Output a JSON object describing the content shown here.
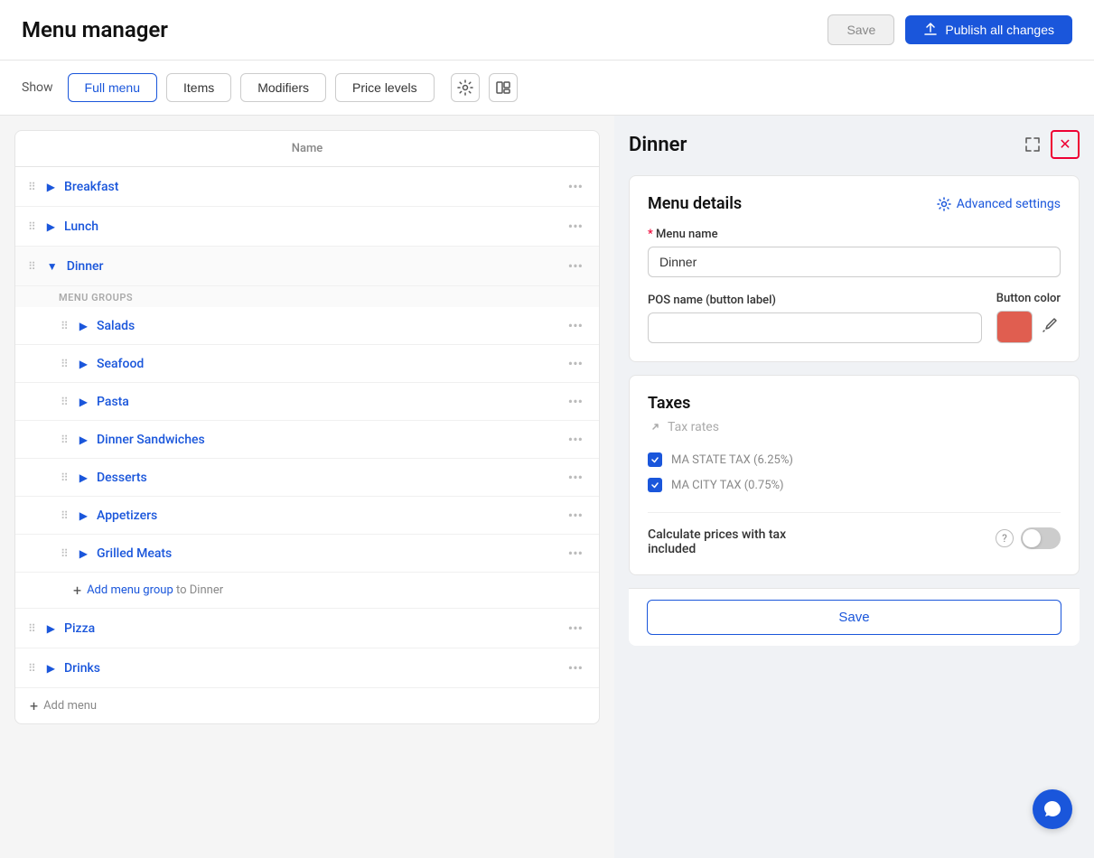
{
  "app": {
    "title": "Menu manager"
  },
  "header": {
    "save_label": "Save",
    "publish_label": "Publish all changes"
  },
  "toolbar": {
    "show_label": "Show",
    "tabs": [
      {
        "id": "full_menu",
        "label": "Full menu",
        "active": true
      },
      {
        "id": "items",
        "label": "Items",
        "active": false
      },
      {
        "id": "modifiers",
        "label": "Modifiers",
        "active": false
      },
      {
        "id": "price_levels",
        "label": "Price levels",
        "active": false
      }
    ]
  },
  "menu_list": {
    "column_header": "Name",
    "items": [
      {
        "id": "breakfast",
        "label": "Breakfast",
        "expanded": false,
        "indent": 0
      },
      {
        "id": "lunch",
        "label": "Lunch",
        "expanded": false,
        "indent": 0
      },
      {
        "id": "dinner",
        "label": "Dinner",
        "expanded": true,
        "indent": 0
      },
      {
        "id": "pizza",
        "label": "Pizza",
        "expanded": false,
        "indent": 0
      },
      {
        "id": "drinks",
        "label": "Drinks",
        "expanded": false,
        "indent": 0
      }
    ],
    "dinner_groups_label": "MENU GROUPS",
    "dinner_groups": [
      {
        "id": "salads",
        "label": "Salads"
      },
      {
        "id": "seafood",
        "label": "Seafood"
      },
      {
        "id": "pasta",
        "label": "Pasta"
      },
      {
        "id": "dinner_sandwiches",
        "label": "Dinner Sandwiches"
      },
      {
        "id": "desserts",
        "label": "Desserts"
      },
      {
        "id": "appetizers",
        "label": "Appetizers"
      },
      {
        "id": "grilled_meats",
        "label": "Grilled Meats"
      }
    ],
    "add_group_text": "Add menu group",
    "add_group_to": "to Dinner",
    "add_menu_text": "Add menu"
  },
  "right_panel": {
    "title": "Dinner",
    "menu_details_card": {
      "title": "Menu details",
      "advanced_settings_label": "Advanced settings",
      "menu_name_label": "Menu name",
      "menu_name_required": true,
      "menu_name_value": "Dinner",
      "pos_name_label": "POS name (button label)",
      "pos_name_value": "",
      "button_color_label": "Button color",
      "button_color": "#e05e50"
    },
    "taxes_card": {
      "title": "Taxes",
      "tax_rates_label": "Tax rates",
      "tax_items": [
        {
          "id": "ma_state",
          "label": "MA STATE TAX (6.25%)",
          "checked": true
        },
        {
          "id": "ma_city",
          "label": "MA CITY TAX (0.75%)",
          "checked": true
        }
      ],
      "calc_label": "Calculate prices with tax included",
      "calc_toggle": false
    },
    "save_label": "Save"
  }
}
